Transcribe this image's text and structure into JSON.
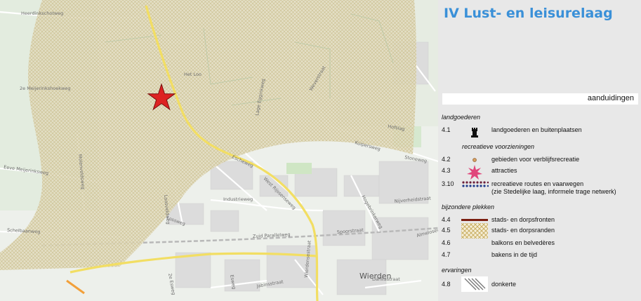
{
  "panel": {
    "title": "IV Lust- en leisurelaag",
    "aanduidingen_label": "aanduidingen",
    "section_landgoederen": "landgoederen",
    "section_recreatieve": "recreatieve voorzieningen",
    "section_bijzondere": "bijzondere plekken",
    "section_ervaringen": "ervaringen",
    "items": [
      {
        "code": "4.1",
        "label": "landgoederen en buitenplaatsen",
        "symbol": "rook-icon"
      },
      {
        "code": "4.2",
        "label": "gebieden voor verblijfsrecreatie",
        "symbol": "dot-icon"
      },
      {
        "code": "4.3",
        "label": "attracties",
        "symbol": "star-burst-icon"
      },
      {
        "code": "3.10",
        "label": "recreatieve routes en vaarwegen",
        "label2": "(zie Stedelijke laag, informele trage netwerk)",
        "symbol": "dotted-route-icon"
      },
      {
        "code": "4.4",
        "label": "stads- en dorpsfronten",
        "symbol": "front-line-icon"
      },
      {
        "code": "4.5",
        "label": "stads- en dorpsranden",
        "symbol": "crosshatch-icon"
      },
      {
        "code": "4.6",
        "label": "balkons en belvedères",
        "symbol": ""
      },
      {
        "code": "4.7",
        "label": "bakens in de tijd",
        "symbol": ""
      },
      {
        "code": "4.8",
        "label": "donkerte",
        "symbol": "diagonal-hatch-icon"
      }
    ]
  },
  "map": {
    "labels": [
      "Heerdinkschotweg",
      "2e Meijerinkshoekweg",
      "Eeve Meijerinksweg",
      "Schelbaanweg",
      "Molenveldsweg",
      "Loosveldweg",
      "Lossweg",
      "Industrieweg",
      "Escheweg",
      "West Rijssenseweg",
      "Zuid Parallelweg",
      "Spoorstraat",
      "Het Loo",
      "Lage Egginkweg",
      "Hofslag",
      "Kuipersweg",
      "Stoneweg",
      "Weverstraat",
      "Nijverheidstraat",
      "Hogebrinkerweg",
      "Almeloseweg",
      "Wierdensestraat",
      "Jabinsstraat",
      "Dahliastraat",
      "2e Esweg",
      "Esweg",
      "Wierden"
    ],
    "highlight_color": "#f0e068",
    "zone_fill_color": "#e4dfc2",
    "star_color": "#dd2222"
  }
}
